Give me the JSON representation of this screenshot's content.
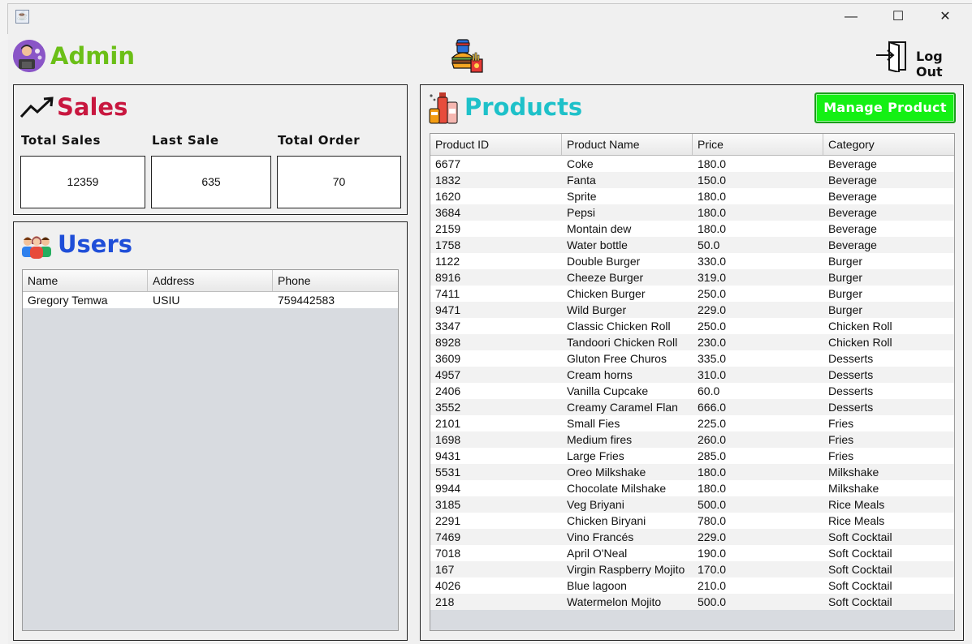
{
  "window": {
    "controls": {
      "minimize": "—",
      "maximize": "☐",
      "close": "✕"
    }
  },
  "header": {
    "title": "Admin",
    "title_color": "#6bbf17",
    "logout_label": "Log Out"
  },
  "sales": {
    "heading": "Sales",
    "heading_color": "#c8173f",
    "stats": [
      {
        "label": "Total Sales",
        "value": "12359"
      },
      {
        "label": "Last Sale",
        "value": "635"
      },
      {
        "label": "Total Order",
        "value": "70"
      }
    ]
  },
  "users": {
    "heading": "Users",
    "heading_color": "#1f4ed8",
    "columns": [
      "Name",
      "Address",
      "Phone"
    ],
    "rows": [
      [
        "Gregory Temwa",
        "USIU",
        "759442583"
      ]
    ]
  },
  "products": {
    "heading": "Products",
    "heading_color": "#1ec1c9",
    "manage_label": "Manage Product",
    "manage_color": "#14f014",
    "columns": [
      "Product ID",
      "Product Name",
      "Price",
      "Category"
    ],
    "rows": [
      [
        "6677",
        "Coke",
        "180.0",
        "Beverage"
      ],
      [
        "1832",
        "Fanta",
        "150.0",
        "Beverage"
      ],
      [
        "1620",
        "Sprite",
        "180.0",
        "Beverage"
      ],
      [
        "3684",
        "Pepsi",
        "180.0",
        "Beverage"
      ],
      [
        "2159",
        "Montain dew",
        "180.0",
        "Beverage"
      ],
      [
        "1758",
        "Water bottle",
        "50.0",
        "Beverage"
      ],
      [
        "1122",
        "Double Burger",
        "330.0",
        "Burger"
      ],
      [
        "8916",
        "Cheeze Burger",
        "319.0",
        "Burger"
      ],
      [
        "7411",
        "Chicken Burger",
        "250.0",
        "Burger"
      ],
      [
        "9471",
        "Wild Burger",
        "229.0",
        "Burger"
      ],
      [
        "3347",
        "Classic Chicken Roll",
        "250.0",
        "Chicken Roll"
      ],
      [
        "8928",
        "Tandoori Chicken Roll",
        "230.0",
        "Chicken Roll"
      ],
      [
        "3609",
        "Gluton Free Churos",
        "335.0",
        "Desserts"
      ],
      [
        "4957",
        "Cream horns",
        "310.0",
        "Desserts"
      ],
      [
        "2406",
        "Vanilla Cupcake",
        "60.0",
        "Desserts"
      ],
      [
        "3552",
        "Creamy Caramel Flan",
        "666.0",
        "Desserts"
      ],
      [
        "2101",
        "Small Fies",
        "225.0",
        "Fries"
      ],
      [
        "1698",
        "Medium fires",
        "260.0",
        "Fries"
      ],
      [
        "9431",
        "Large Fries",
        "285.0",
        "Fries"
      ],
      [
        "5531",
        "Oreo Milkshake",
        "180.0",
        "Milkshake"
      ],
      [
        "9944",
        "Chocolate Milshake",
        "180.0",
        "Milkshake"
      ],
      [
        "3185",
        "Veg Briyani",
        "500.0",
        "Rice Meals"
      ],
      [
        "2291",
        "Chicken Biryani",
        "780.0",
        "Rice Meals"
      ],
      [
        "7469",
        "Vino Francés",
        "229.0",
        "Soft Cocktail"
      ],
      [
        "7018",
        "April O'Neal",
        "190.0",
        "Soft Cocktail"
      ],
      [
        "167",
        "Virgin Raspberry Mojito",
        "170.0",
        "Soft Cocktail"
      ],
      [
        "4026",
        "Blue lagoon",
        "210.0",
        "Soft Cocktail"
      ],
      [
        "218",
        "Watermelon Mojito",
        "500.0",
        "Soft Cocktail"
      ]
    ]
  }
}
